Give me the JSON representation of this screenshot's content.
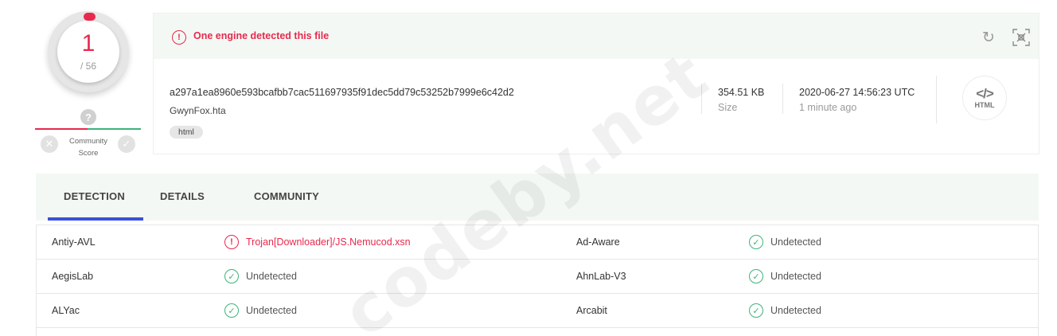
{
  "score": {
    "detections": "1",
    "total": "/ 56"
  },
  "community": {
    "label": "Community Score",
    "question_mark": "?"
  },
  "banner": {
    "message": "One engine detected this file",
    "icon_symbol": "!"
  },
  "file": {
    "sha256": "a297a1ea8960e593bcafbb7cac511697935f91dec5dd79c53252b7999e6c42d2",
    "name": "GwynFox.hta",
    "tag": "html",
    "size_value": "354.51 KB",
    "size_label": "Size",
    "date_value": "2020-06-27 14:56:23 UTC",
    "date_label": "1 minute ago",
    "type_icon": {
      "code": "</>",
      "label": "HTML"
    }
  },
  "tabs": [
    {
      "label": "DETECTION",
      "active": true
    },
    {
      "label": "DETAILS",
      "active": false
    },
    {
      "label": "COMMUNITY",
      "active": false
    }
  ],
  "results": [
    {
      "left": {
        "engine": "Antiy-AVL",
        "result": "Trojan[Downloader]/JS.Nemucod.xsn",
        "detected": true
      },
      "right": {
        "engine": "Ad-Aware",
        "result": "Undetected",
        "detected": false
      }
    },
    {
      "left": {
        "engine": "AegisLab",
        "result": "Undetected",
        "detected": false
      },
      "right": {
        "engine": "AhnLab-V3",
        "result": "Undetected",
        "detected": false
      }
    },
    {
      "left": {
        "engine": "ALYac",
        "result": "Undetected",
        "detected": false
      },
      "right": {
        "engine": "Arcabit",
        "result": "Undetected",
        "detected": false
      }
    }
  ],
  "watermark": "codeby.net",
  "colors": {
    "alert": "#e8294d",
    "ok": "#3db37a",
    "tab_accent": "#3b51d8",
    "panel_bg": "#f4f8f4"
  }
}
